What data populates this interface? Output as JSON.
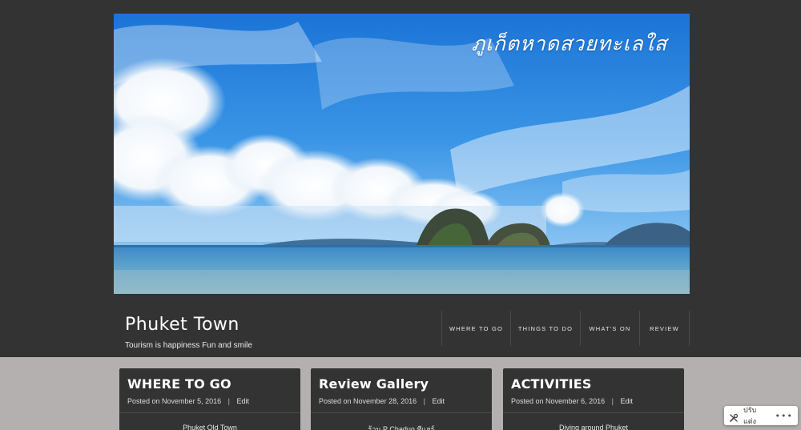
{
  "banner": {
    "caption": "ภูเก็ตหาดสวยทะเลใส"
  },
  "site": {
    "title": "Phuket Town",
    "description": "Tourism is happiness Fun and smile"
  },
  "nav": {
    "items": [
      {
        "label": "WHERE TO GO"
      },
      {
        "label": "THINGS TO DO"
      },
      {
        "label": "WHAT'S ON"
      },
      {
        "label": "REVIEW"
      }
    ]
  },
  "posts": [
    {
      "title": "WHERE TO GO",
      "posted_on": "Posted on",
      "date": "November 5, 2016",
      "edit": "Edit",
      "excerpt": "Phuket Old Town"
    },
    {
      "title": "Review Gallery",
      "posted_on": "Posted on",
      "date": "November 28, 2016",
      "edit": "Edit",
      "excerpt": "ร้าน P Chaduo ทีแฮร์"
    },
    {
      "title": "ACTIVITIES",
      "posted_on": "Posted on",
      "date": "November 6, 2016",
      "edit": "Edit",
      "excerpt": "Diving around Phuket"
    }
  ],
  "customize": {
    "label": "ปรับแต่ง",
    "more": "•••",
    "icon": "tools-icon"
  },
  "colors": {
    "header_bg": "#333333",
    "content_bg": "#b5b0b0",
    "card_bg": "#333333",
    "text_light": "#ffffff"
  }
}
